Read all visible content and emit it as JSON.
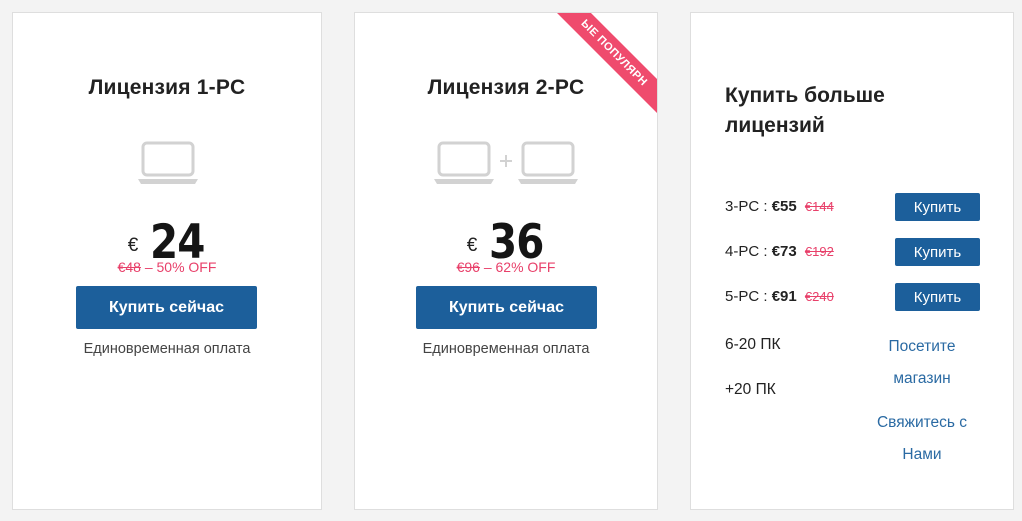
{
  "colors": {
    "button": "#1c5f9b",
    "discount": "#e8406a",
    "ribbon": "#ef4b6d",
    "link": "#2a6aa3"
  },
  "card1": {
    "title": "Лицензия 1-PC",
    "icon": "laptop-icon",
    "currency": "€",
    "price": "24",
    "old_price": "€48",
    "discount_text": " – 50% OFF",
    "button_label": "Купить сейчас",
    "note": "Единовременная оплата"
  },
  "card2": {
    "title": "Лицензия 2-PC",
    "ribbon": "ые популярн",
    "icons": [
      "laptop-icon",
      "plus-icon",
      "laptop-icon"
    ],
    "currency": "€",
    "price": "36",
    "old_price": "€96",
    "discount_text": " – 62% OFF",
    "button_label": "Купить сейчас",
    "note": "Единовременная оплата"
  },
  "card3": {
    "title": "Купить больше лицензий",
    "tiers": [
      {
        "label": "3-PC : ",
        "price": "€55",
        "old": "€144",
        "button": "Купить"
      },
      {
        "label": "4-PC : ",
        "price": "€73",
        "old": "€192",
        "button": "Купить"
      },
      {
        "label": "5-PC : ",
        "price": "€91",
        "old": "€240",
        "button": "Купить"
      }
    ],
    "row_6_20": "6-20 ПК",
    "row_20_plus": "+20 ПК",
    "visit_store_link": "Посетите магазин",
    "contact_link": "Свяжитесь с Нами"
  }
}
